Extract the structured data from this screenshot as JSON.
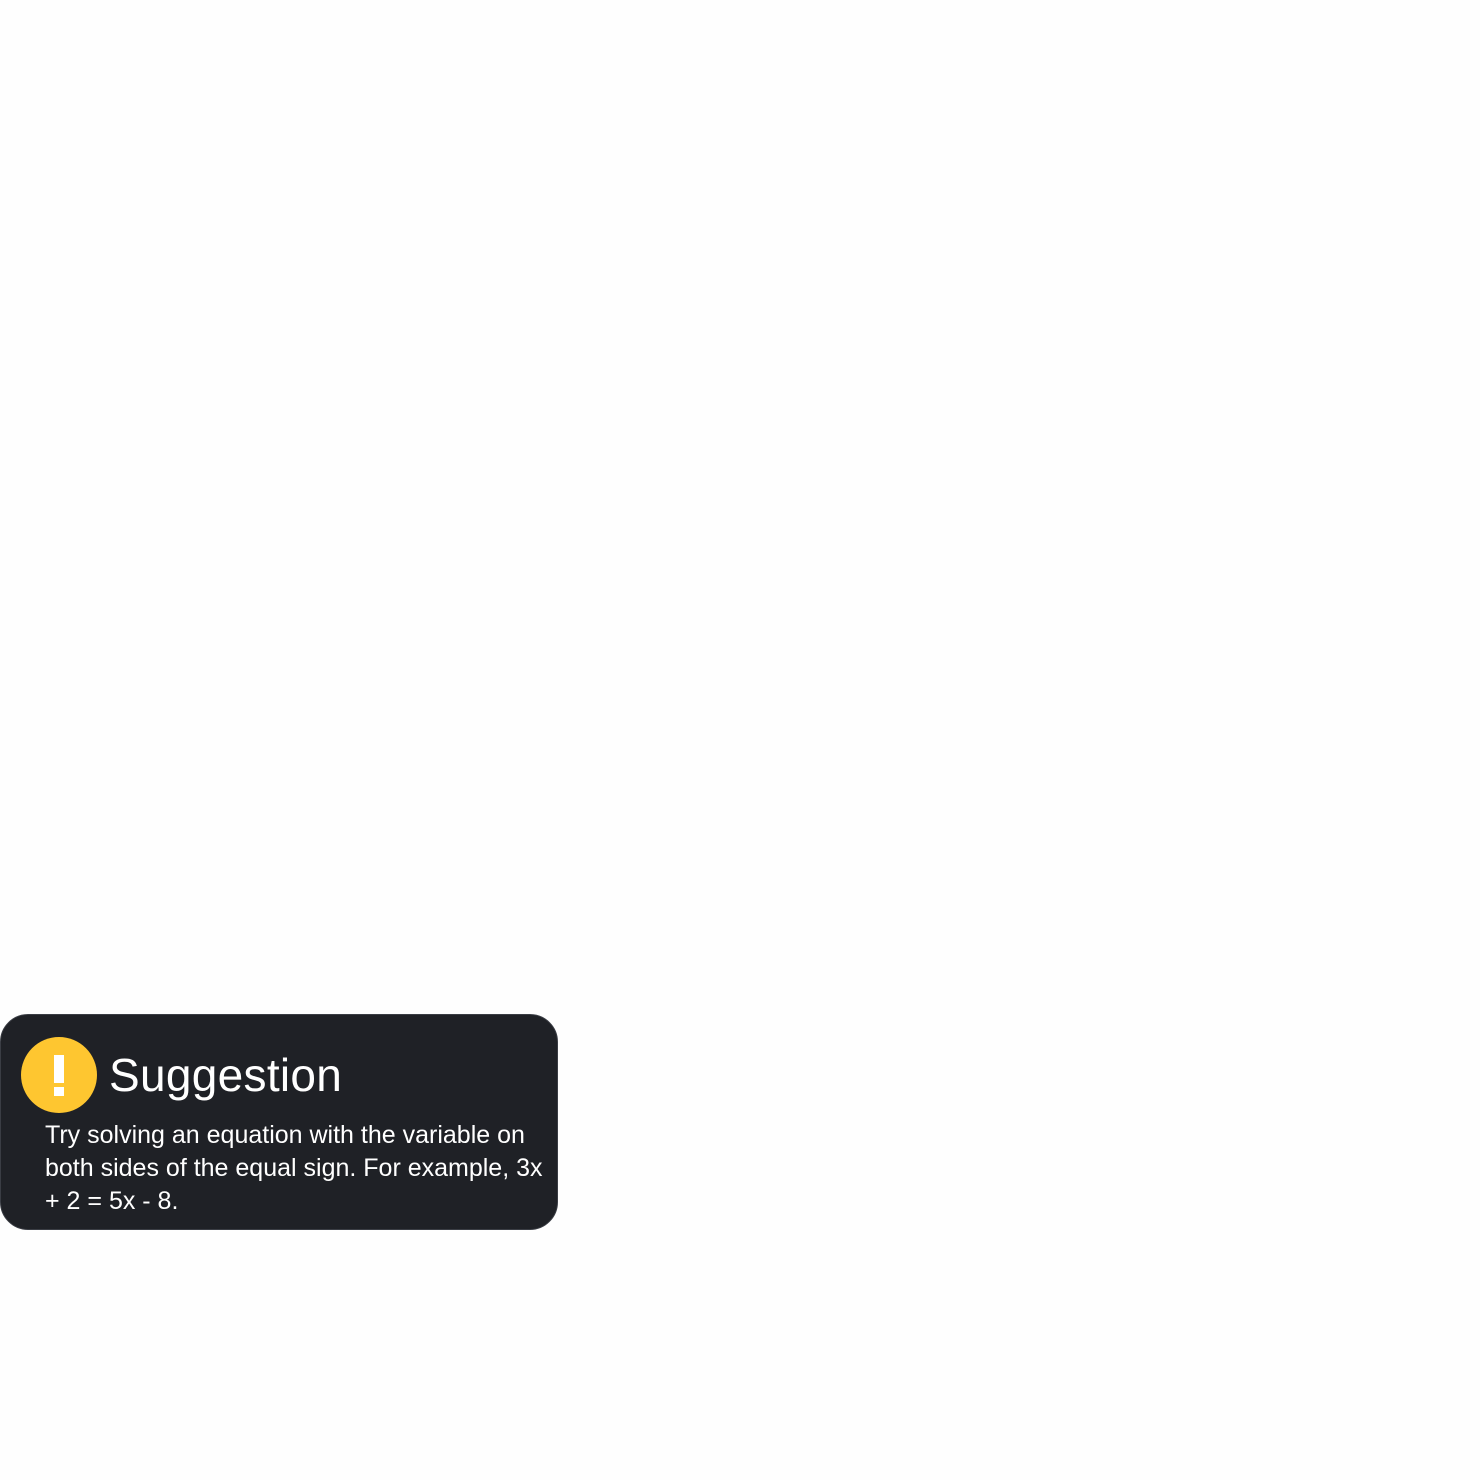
{
  "suggestion": {
    "icon": "exclamation-icon",
    "title": "Suggestion",
    "body": "Try solving an equation with the variable on both sides of the equal sign. For example, 3x + 2 = 5x - 8."
  },
  "colors": {
    "page_background": "#fefefe",
    "card_background": "#1f2126",
    "icon_background": "#fec630",
    "text": "#ffffff"
  }
}
